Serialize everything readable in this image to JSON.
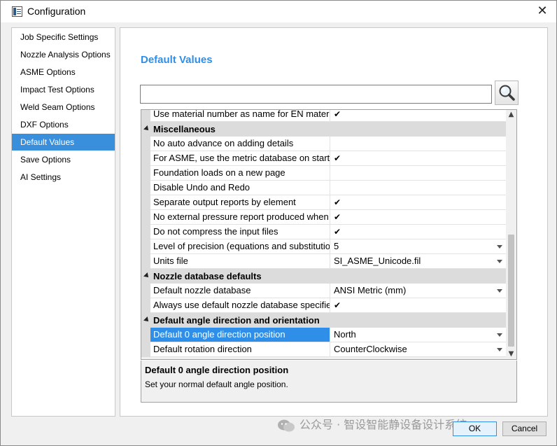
{
  "window": {
    "title": "Configuration",
    "close_glyph": "✕"
  },
  "sidebar": {
    "items": [
      {
        "label": "Job Specific Settings"
      },
      {
        "label": "Nozzle Analysis Options"
      },
      {
        "label": "ASME Options"
      },
      {
        "label": "Impact Test Options"
      },
      {
        "label": "Weld Seam Options"
      },
      {
        "label": "DXF Options"
      },
      {
        "label": "Default Values",
        "active": true
      },
      {
        "label": "Save Options"
      },
      {
        "label": "AI Settings"
      }
    ]
  },
  "main": {
    "heading": "Default Values",
    "search": {
      "value": "",
      "placeholder": "",
      "icon": "search-icon"
    }
  },
  "grid": {
    "rows": [
      {
        "type": "prop",
        "name": "Use material number as name for EN materials",
        "value": "✔"
      },
      {
        "type": "category",
        "name": "Miscellaneous"
      },
      {
        "type": "prop",
        "name": "No auto advance on adding details",
        "value": ""
      },
      {
        "type": "prop",
        "name": "For ASME, use the metric database on startup",
        "value": "✔"
      },
      {
        "type": "prop",
        "name": "Foundation loads on a new page",
        "value": ""
      },
      {
        "type": "prop",
        "name": "Disable Undo and Redo",
        "value": ""
      },
      {
        "type": "prop",
        "name": "Separate output reports by element",
        "value": "✔"
      },
      {
        "type": "prop",
        "name": "No external pressure report produced when",
        "value": "✔"
      },
      {
        "type": "prop",
        "name": "Do not compress the input files",
        "value": "✔"
      },
      {
        "type": "prop",
        "name": "Level of precision (equations and substitution",
        "value": "5",
        "dropdown": true
      },
      {
        "type": "prop",
        "name": "Units file",
        "value": "SI_ASME_Unicode.fil",
        "dropdown": true
      },
      {
        "type": "category",
        "name": "Nozzle database defaults"
      },
      {
        "type": "prop",
        "name": "Default nozzle database",
        "value": "ANSI Metric (mm)",
        "dropdown": true
      },
      {
        "type": "prop",
        "name": "Always use default nozzle database specified",
        "value": "✔"
      },
      {
        "type": "category",
        "name": "Default angle direction and orientation"
      },
      {
        "type": "prop",
        "name": "Default 0 angle direction position",
        "value": "North",
        "dropdown": true,
        "selected": true
      },
      {
        "type": "prop",
        "name": "Default rotation direction",
        "value": "CounterClockwise",
        "dropdown": true
      }
    ]
  },
  "description": {
    "title": "Default 0 angle direction position",
    "text": "Set your normal default angle position."
  },
  "watermark": "公众号 · 智设智能静设备设计系统",
  "buttons": {
    "ok": "OK",
    "cancel": "Cancel"
  },
  "colors": {
    "accent": "#2e8ee8",
    "selection": "#3a8fdc",
    "category_bg": "#dcdcdc"
  }
}
